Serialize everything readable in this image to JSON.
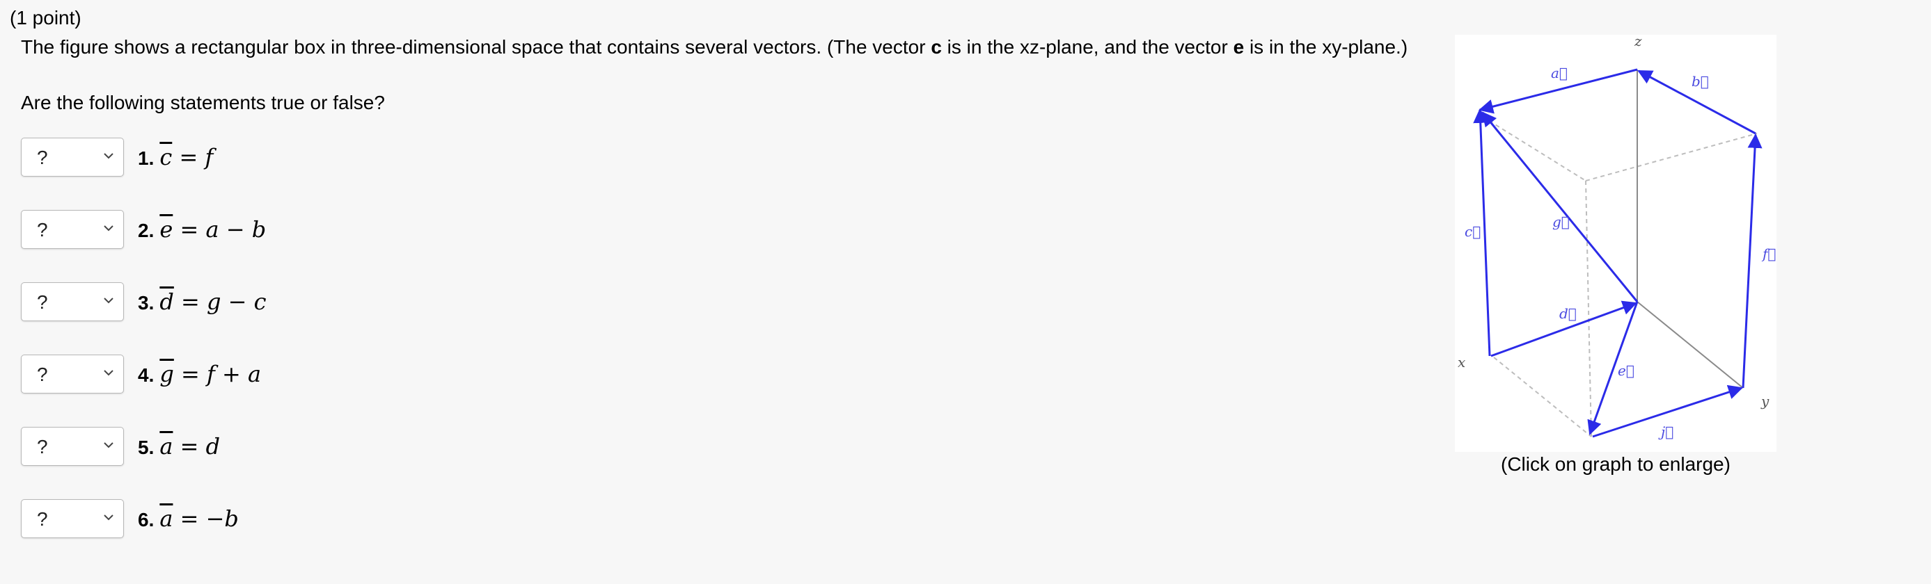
{
  "header": {
    "points": "(1 point)",
    "prompt": {
      "part1": "The figure shows a rectangular box in three-dimensional space that contains several vectors. (The vector ",
      "vec_c": "c",
      "part2": " is in the xz-plane, and the vector ",
      "vec_e": "e",
      "part3": " is in the xy-plane.)"
    },
    "question": "Are the following statements true or false?"
  },
  "statements": [
    {
      "number": "1.",
      "selected": "?",
      "lhs": "c",
      "rhs": "= f"
    },
    {
      "number": "2.",
      "selected": "?",
      "lhs": "e",
      "rhs": "= a − b"
    },
    {
      "number": "3.",
      "selected": "?",
      "lhs": "d",
      "rhs": "= g − c"
    },
    {
      "number": "4.",
      "selected": "?",
      "lhs": "g",
      "rhs": "= f + a"
    },
    {
      "number": "5.",
      "selected": "?",
      "lhs": "a",
      "rhs": "= d"
    },
    {
      "number": "6.",
      "selected": "?",
      "lhs": "a",
      "rhs": "= −b"
    }
  ],
  "figure": {
    "caption": "(Click on graph to enlarge)",
    "axis_labels": {
      "x": "x",
      "y": "y",
      "z": "z"
    },
    "vector_labels": {
      "a": "a⃗",
      "b": "b⃗",
      "c": "c⃗",
      "d": "d⃗",
      "e": "e⃗",
      "f": "f⃗",
      "g": "g⃗",
      "j": "j⃗"
    },
    "colors": {
      "vector": "#2b2be8",
      "dashed": "#bdbdbd",
      "axis": "#8a8a8a"
    }
  }
}
